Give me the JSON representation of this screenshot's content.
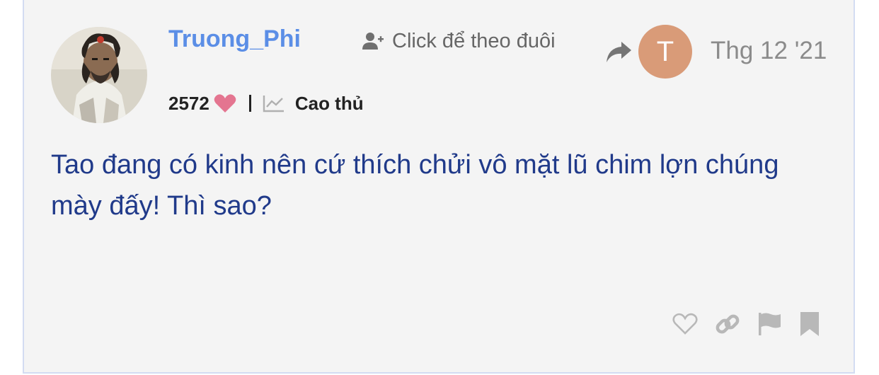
{
  "post": {
    "username": "Truong_Phi",
    "follow_label": "Click để theo đuôi",
    "reply_avatar_letter": "T",
    "date": "Thg 12 '21",
    "likes": "2572",
    "rank": "Cao thủ",
    "content": "Tao đang có kinh nên cứ thích chửi vô mặt lũ chim lợn chúng mày đấy! Thì sao?"
  },
  "icons": {
    "follow": "add-user-icon",
    "share": "share-icon",
    "heart": "heart-icon",
    "rank": "line-chart-icon",
    "actions": [
      "heart-outline-icon",
      "link-icon",
      "flag-icon",
      "bookmark-icon"
    ]
  },
  "colors": {
    "background": "#f4f4f4",
    "username": "#5b8ee6",
    "content": "#203a8a",
    "heart": "#e47590",
    "mini_avatar": "#d99b78",
    "muted": "#8b8b8b"
  }
}
